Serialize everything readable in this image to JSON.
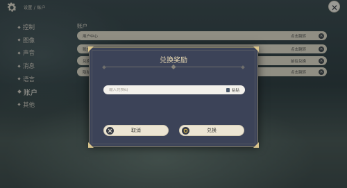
{
  "header": {
    "breadcrumb": "设置 / 账户",
    "gear_icon": "gear-icon",
    "close_icon": "close-icon"
  },
  "sidebar": {
    "items": [
      {
        "label": "控制"
      },
      {
        "label": "图像"
      },
      {
        "label": "声音"
      },
      {
        "label": "消息"
      },
      {
        "label": "语言"
      },
      {
        "label": "账户",
        "active": true
      },
      {
        "label": "其他"
      }
    ]
  },
  "account": {
    "title": "账户",
    "rows": [
      {
        "label": "用户中心",
        "action": "点击跳转"
      },
      {
        "label": "账户",
        "action": "点击跳转"
      },
      {
        "label": "兑换",
        "action": "前往兑换"
      },
      {
        "label": "隐私",
        "action": "点击跳转"
      }
    ]
  },
  "dialog": {
    "title": "兑换奖励",
    "input_placeholder": "输入兑换码",
    "input_value": "",
    "paste_label": "粘贴",
    "cancel_label": "取消",
    "confirm_label": "兑换"
  },
  "colors": {
    "dialog_bg": "#3c4358",
    "title_gold": "#ecdcb4",
    "button_bg": "#ece5d3",
    "row_bg": "#d9d3c1"
  }
}
